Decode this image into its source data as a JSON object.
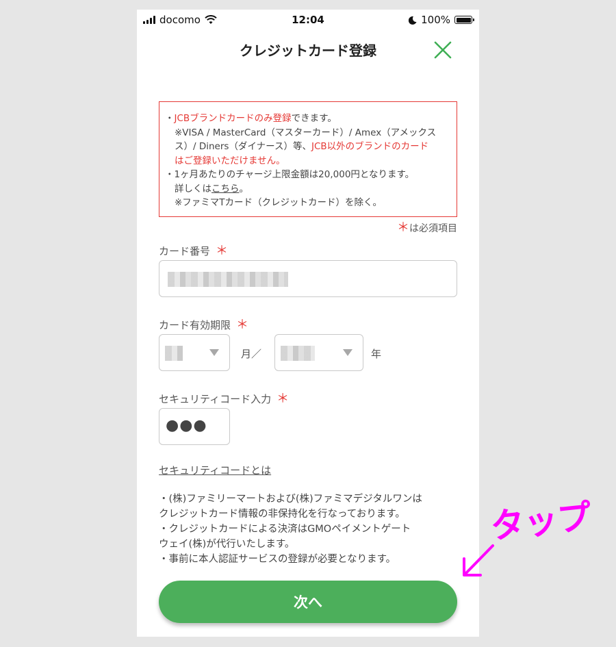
{
  "status": {
    "carrier": "docomo",
    "time": "12:04",
    "battery": "100%"
  },
  "header": {
    "title": "クレジットカード登録"
  },
  "notice": {
    "bullet": "・",
    "line1_red": "JCBブランドカードのみ登録",
    "line1_rest": "できます。",
    "line2": "※VISA / MasterCard（マスターカード）/ Amex（アメックス",
    "line3_normal": "ス）/ Diners（ダイナース）等、",
    "line3_red": "JCB以外のブランドのカード",
    "line4_red": "はご登録いただけません。",
    "line5": "1ヶ月あたりのチャージ上限金額は20,000円となります。",
    "line6_pre": "詳しくは",
    "line6_link": "こちら",
    "line6_post": "。",
    "line7": "※ファミマTカード（クレジットカード）を除く。"
  },
  "required_note": {
    "asterisk": "＊",
    "text": "は必須項目"
  },
  "fields": {
    "asterisk": "＊",
    "card_number": {
      "label": "カード番号"
    },
    "expiry": {
      "label": "カード有効期限",
      "month_suffix": "月／",
      "year_suffix": "年"
    },
    "cvc": {
      "label": "セキュリティコード入力",
      "value": "●●●"
    }
  },
  "security_link": "セキュリティコードとは",
  "info": [
    "・(株)ファミリーマートおよび(株)ファミマデジタルワンは",
    "クレジットカード情報の非保持化を行なっております。",
    "・クレジットカードによる決済はGMOペイメントゲート",
    "ウェイ(株)が代行いたします。",
    "・事前に本人認証サービスの登録が必要となります。"
  ],
  "next_button": "次へ",
  "annotation": {
    "text": "タップ",
    "color": "#ff00ff"
  },
  "colors": {
    "accent": "#4caf5b",
    "required": "#e53935"
  }
}
